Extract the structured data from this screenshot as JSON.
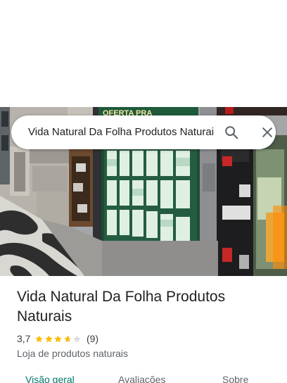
{
  "search": {
    "query": "Vida Natural Da Folha Produtos Naturais"
  },
  "place": {
    "name": "Vida Natural Da Folha Produtos Naturais",
    "rating_text": "3,7",
    "rating": 3.7,
    "max_rating": 5,
    "review_count": "(9)",
    "category": "Loja de produtos naturais"
  },
  "tabs": [
    {
      "label": "Visão geral",
      "active": true
    },
    {
      "label": "Avaliações",
      "active": false
    },
    {
      "label": "Sobre",
      "active": false
    }
  ],
  "photo": {
    "sign_text": "OFERTA PRA"
  },
  "colors": {
    "star": "#fbbc04",
    "star_empty": "#dadce0",
    "active_tab": "#00796b"
  }
}
